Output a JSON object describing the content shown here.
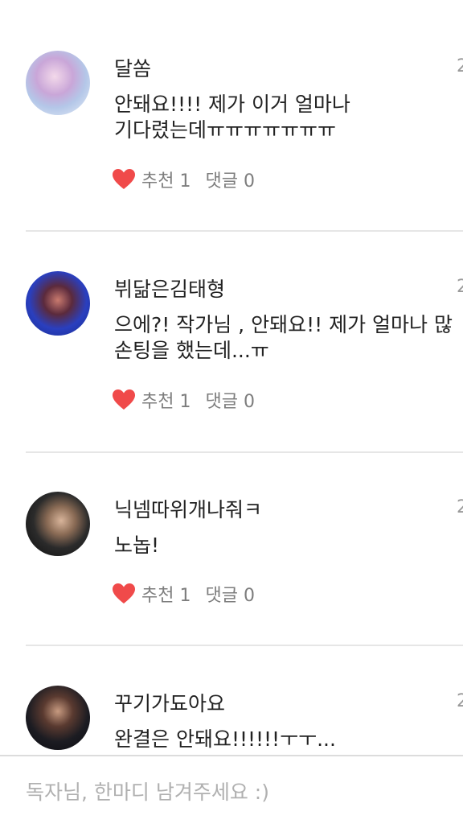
{
  "comments": [
    {
      "author": "달쏨",
      "date": "2",
      "text_lines": [
        "안돼요!!!! 제가 이거 얼마나",
        "기다렸는데ㅠㅠㅠㅠㅠㅠㅠ"
      ],
      "likes": "추천 1",
      "replies": "댓글 0"
    },
    {
      "author": "뷔닮은김태형",
      "date": "2",
      "text_lines": [
        "으에?! 작가님 , 안돼요!! 제가 얼마나 많",
        "손팅을 했는데...ㅠ"
      ],
      "likes": "추천 1",
      "replies": "댓글 0"
    },
    {
      "author": "닉넴따위개나줘ㅋ",
      "date": "2",
      "text_lines": [
        "노놉!"
      ],
      "likes": "추천 1",
      "replies": "댓글 0"
    },
    {
      "author": "꾸기가됴아요",
      "date": "2",
      "text_lines": [
        "완결은 안돼요!!!!!!ㅜㅜ..."
      ]
    }
  ],
  "input": {
    "placeholder": "독자님, 한마디 남겨주세요 :)"
  },
  "icons": {
    "like": "heart-icon"
  },
  "colors": {
    "heart": "#f04a4a",
    "divider": "#e6e6e6",
    "meta_text": "#7d7d7d",
    "placeholder": "#b0b0b0"
  }
}
